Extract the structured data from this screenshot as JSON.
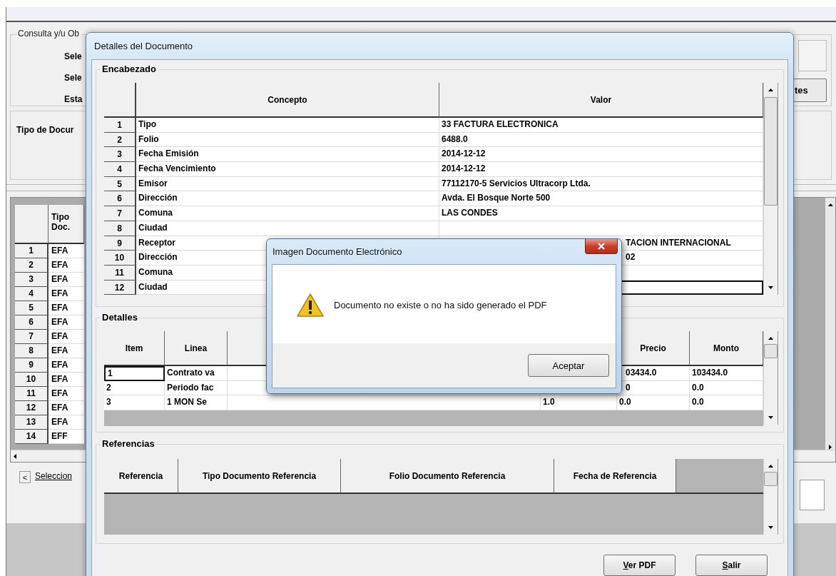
{
  "background_window": {
    "group_title": "Consulta y/u Ob",
    "labels": [
      "Sele",
      "Sele",
      "Esta"
    ],
    "right_button": "tes",
    "panel_label": "Tipo de Docur",
    "table": {
      "columns": [
        "Tipo Doc."
      ],
      "rows": [
        {
          "number": "1",
          "tipo": "EFA"
        },
        {
          "number": "2",
          "tipo": "EFA"
        },
        {
          "number": "3",
          "tipo": "EFA"
        },
        {
          "number": "4",
          "tipo": "EFA"
        },
        {
          "number": "5",
          "tipo": "EFA"
        },
        {
          "number": "6",
          "tipo": "EFA"
        },
        {
          "number": "7",
          "tipo": "EFA"
        },
        {
          "number": "8",
          "tipo": "EFA"
        },
        {
          "number": "9",
          "tipo": "EFA"
        },
        {
          "number": "10",
          "tipo": "EFA"
        },
        {
          "number": "11",
          "tipo": "EFA"
        },
        {
          "number": "12",
          "tipo": "EFA"
        },
        {
          "number": "13",
          "tipo": "EFA"
        },
        {
          "number": "14",
          "tipo": "EFF"
        }
      ]
    },
    "back_button": "<",
    "link": "Seleccion"
  },
  "dialog": {
    "title": "Detalles del Documento",
    "encabezado": {
      "title": "Encabezado",
      "columns": [
        "Concepto",
        "Valor"
      ],
      "rows": [
        {
          "number": "1",
          "concepto": "Tipo",
          "valor": "33 FACTURA ELECTRONICA",
          "kind": "full",
          "selected": false
        },
        {
          "number": "2",
          "concepto": "Folio",
          "valor": "6488.0",
          "kind": "full",
          "selected": false
        },
        {
          "number": "3",
          "concepto": "Fecha Emisión",
          "valor": "2014-12-12",
          "kind": "full",
          "selected": false
        },
        {
          "number": "4",
          "concepto": "Fecha Vencimiento",
          "valor": "2014-12-12",
          "kind": "full",
          "selected": false
        },
        {
          "number": "5",
          "concepto": "Emisor",
          "valor": "77112170-5 Servicios Ultracorp Ltda.",
          "kind": "full",
          "selected": false
        },
        {
          "number": "6",
          "concepto": "Dirección",
          "valor": "Avda. El Bosque Norte 500",
          "kind": "full",
          "selected": false
        },
        {
          "number": "7",
          "concepto": "Comuna",
          "valor": "LAS CONDES",
          "kind": "full",
          "selected": false
        },
        {
          "number": "8",
          "concepto": "Ciudad",
          "kind": "full",
          "selected": false
        },
        {
          "number": "9",
          "concepto": "Receptor",
          "valor": "TACION INTERNACIONAL",
          "kind": "partial",
          "selected": false
        },
        {
          "number": "10",
          "concepto": "Dirección",
          "valor": "02",
          "kind": "partial",
          "selected": false
        },
        {
          "number": "11",
          "concepto": "Comuna",
          "kind": "partial",
          "selected": false
        },
        {
          "number": "12",
          "concepto": "Ciudad",
          "kind": "partial",
          "selected": true
        }
      ]
    },
    "detalles": {
      "title": "Detalles",
      "columns": {
        "item": "Item",
        "linea": "Linea",
        "precio": "Precio",
        "monto": "Monto"
      },
      "rows": [
        {
          "item": "1",
          "linea": "Contrato va",
          "precio": "03434.0",
          "monto": "103434.0",
          "covered": true,
          "selected": true
        },
        {
          "item": "2",
          "linea": "Periodo fac",
          "precio": "0",
          "monto": "0.0",
          "covered": true,
          "selected": false
        },
        {
          "item": "3",
          "linea": "1  MON Se",
          "column_4": "1.0",
          "precio": "0.0",
          "monto": "0.0",
          "covered": false,
          "selected": false
        }
      ]
    },
    "referencias": {
      "title": "Referencias",
      "columns": [
        "Referencia",
        "Tipo Documento Referencia",
        "Folio Documento Referencia",
        "Fecha de Referencia"
      ]
    },
    "buttons": [
      "Ver PDF",
      "Salir"
    ]
  },
  "message_box": {
    "title": "Imagen Documento Electrónico",
    "message": "Documento no existe o no ha sido generado el PDF",
    "button": "Aceptar"
  }
}
